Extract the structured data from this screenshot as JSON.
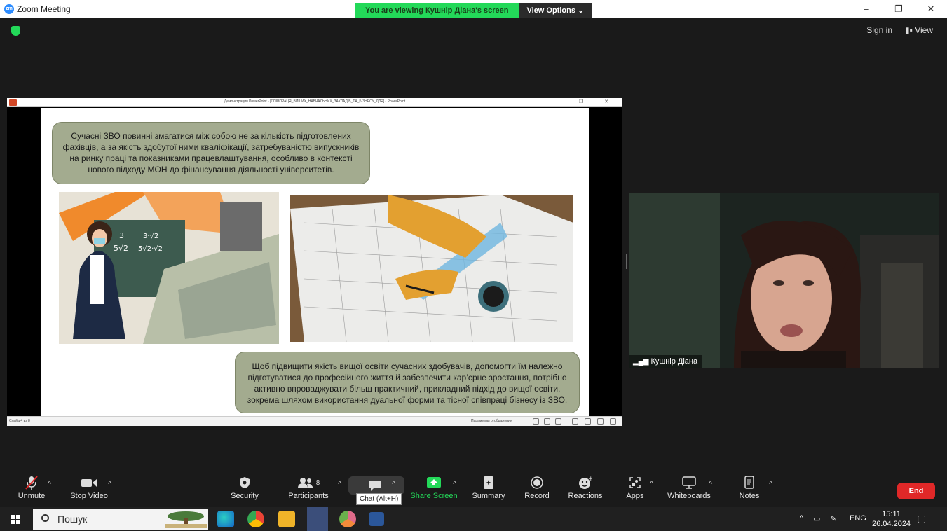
{
  "window": {
    "app_title": "Zoom Meeting",
    "controls": [
      "–",
      "❐",
      "✕"
    ]
  },
  "banner": {
    "viewing_text": "You are viewing Кушнір Діана's screen",
    "view_options": "View Options ⌄"
  },
  "top_right": {
    "sign_in": "Sign in",
    "view": "View"
  },
  "powerpoint": {
    "title": "Демонстрация PowerPoint - [СПІВПРАЦЯ_ВИЩИХ_НАВЧАЛЬНИХ_ЗАКЛАДІВ_ТА_БІЗНЕСУ_ДЛЯ] - PowerPoint",
    "controls": "— ❐ ✕",
    "slide_number": "Слайд 4 из 8",
    "display_params": "Параметры отображения",
    "slide_text_top": "Сучасні ЗВО повинні змагатися між собою не за кількість підготовлених фахівців, а за якість здобутої ними кваліфікації, затребуваністю випускників на ринку праці та показниками працевлаштування, особливо в контексті нового підходу МОН до фінансування діяльності університетів.",
    "slide_text_bottom": "Щоб підвищити якість вищої освіти сучасних здобувачів, допомогти їм належно підготуватися до професійного життя й забезпечити кар’єрне зростання, потрібно активно впроваджувати більш практичний, прикладний підхід до вищої освіти, зокрема шляхом використання дуальної форми та тісної співпраці бізнесу із ЗВО.",
    "fraction_left": "3/5√2",
    "fraction_right": "3·√2/5√2·√2"
  },
  "video": {
    "participant_name": "Кушнір Діана"
  },
  "toolbar": {
    "unmute": "Unmute",
    "stop_video": "Stop Video",
    "security": "Security",
    "participants": "Participants",
    "participants_count": "8",
    "chat_tooltip": "Chat (Alt+H)",
    "share_screen": "Share Screen",
    "summary": "Summary",
    "record": "Record",
    "reactions": "Reactions",
    "apps": "Apps",
    "whiteboards": "Whiteboards",
    "notes": "Notes",
    "end": "End"
  },
  "taskbar": {
    "search": "Пошук",
    "lang": "ENG",
    "time": "15:11",
    "date": "26.04.2024"
  },
  "colors": {
    "share_green": "#23d959",
    "end_red": "#e02828",
    "slide_box": "#a3ab8f"
  }
}
